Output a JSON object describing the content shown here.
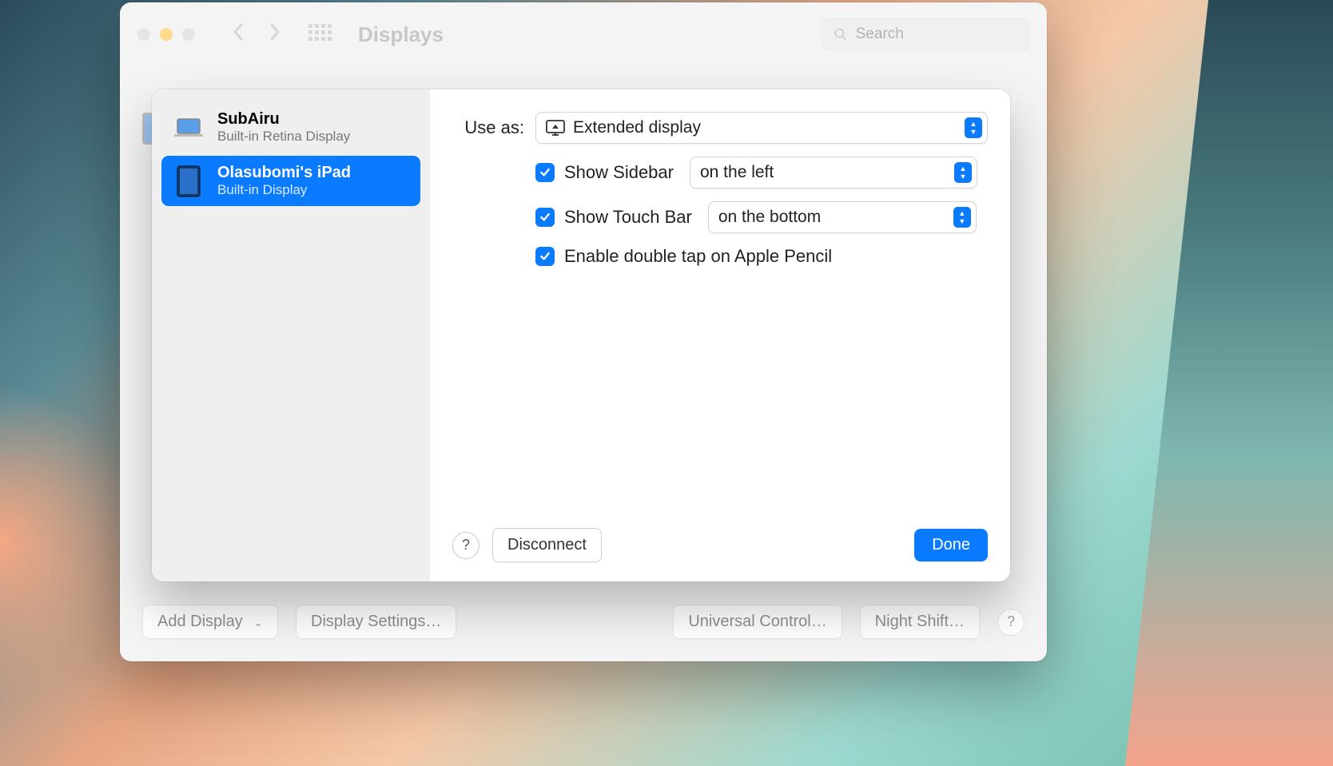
{
  "window": {
    "title": "Displays",
    "search_placeholder": "Search"
  },
  "bottom": {
    "add_display": "Add Display",
    "display_settings": "Display Settings…",
    "universal_control": "Universal Control…",
    "night_shift": "Night Shift…"
  },
  "sheet": {
    "devices": [
      {
        "name": "SubAiru",
        "sub": "Built-in Retina Display"
      },
      {
        "name": "Olasubomi's iPad",
        "sub": "Built-in Display"
      }
    ],
    "use_as_label": "Use as:",
    "use_as_value": "Extended display",
    "show_sidebar_label": "Show Sidebar",
    "show_sidebar_value": "on the left",
    "show_touchbar_label": "Show Touch Bar",
    "show_touchbar_value": "on the bottom",
    "pencil_label": "Enable double tap on Apple Pencil",
    "disconnect": "Disconnect",
    "done": "Done",
    "help": "?"
  }
}
